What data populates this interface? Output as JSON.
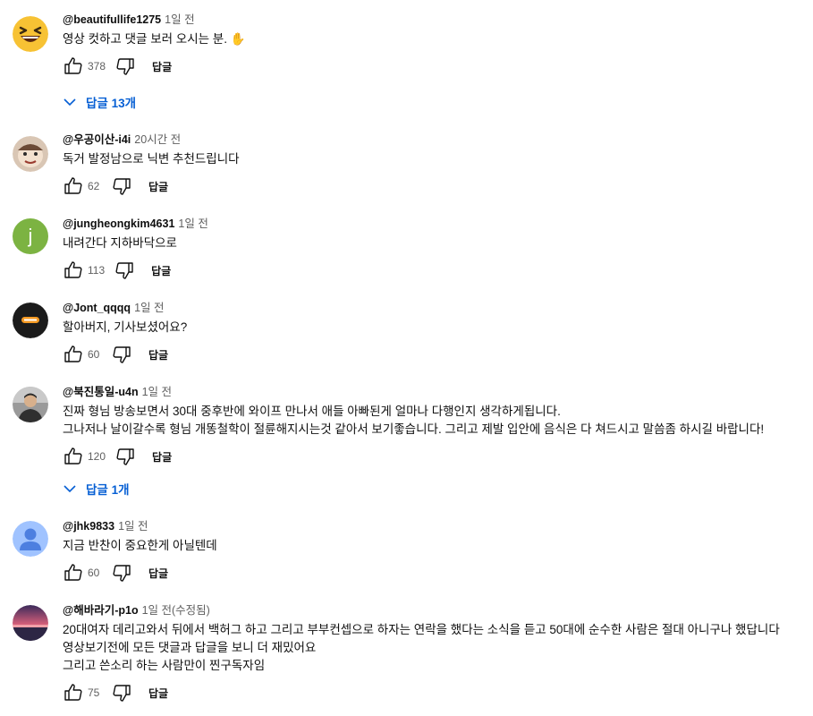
{
  "comments": [
    {
      "author": "@beautifullife1275",
      "time": "1일 전",
      "lines": [
        "영상 컷하고 댓글 보러 오시는 분. ✋"
      ],
      "likes": "378",
      "reply_label": "답글",
      "replies_label": "답글 13개",
      "avatar_icon": "laughing-emoji-avatar",
      "avatar_color": "#f7c234"
    },
    {
      "author": "@우공이산-i4i",
      "time": "20시간 전",
      "lines": [
        "독거 발정남으로 닉변 추천드립니다"
      ],
      "likes": "62",
      "reply_label": "답글",
      "avatar_icon": "cartoon-face-avatar",
      "avatar_color": "#d9c6b4"
    },
    {
      "author": "@jungheongkim4631",
      "time": "1일 전",
      "lines": [
        "내려간다 지하바닥으로"
      ],
      "likes": "113",
      "reply_label": "답글",
      "avatar_letter": "j",
      "avatar_color": "#7cb342"
    },
    {
      "author": "@Jont_qqqq",
      "time": "1일 전",
      "lines": [
        "할아버지, 기사보셨어요?"
      ],
      "likes": "60",
      "reply_label": "답글",
      "avatar_icon": "dark-logo-avatar",
      "avatar_color": "#1b1b1b"
    },
    {
      "author": "@북진통일-u4n",
      "time": "1일 전",
      "lines": [
        "진짜 형님 방송보면서 30대 중후반에 와이프 만나서 애들 아빠된게 얼마나 다행인지 생각하게됩니다.",
        "그나저나 날이갈수록 형님 개똥철학이 절륜해지시는것 같아서 보기좋습니다. 그리고 제발 입안에 음식은 다 쳐드시고 말씀좀 하시길 바랍니다!"
      ],
      "likes": "120",
      "reply_label": "답글",
      "replies_label": "답글 1개",
      "avatar_icon": "person-photo-avatar",
      "avatar_color": "#8d8d8d"
    },
    {
      "author": "@jhk9833",
      "time": "1일 전",
      "lines": [
        "지금 반찬이 중요한게 아닐텐데"
      ],
      "likes": "60",
      "reply_label": "답글",
      "avatar_icon": "default-person-avatar",
      "avatar_color": "#a0c3ff"
    },
    {
      "author": "@해바라기-p1o",
      "time": "1일 전(수정됨)",
      "lines": [
        "20대여자 데리고와서 뒤에서 백허그 하고 그리고 부부컨셉으로 하자는 연락을 했다는 소식을 듣고 50대에 순수한 사람은 절대 아니구나 했답니다",
        "영상보기전에 모든 댓글과 답글을 보니 더 재밌어요",
        "그리고 쓴소리 하는 사람만이 찐구독자임"
      ],
      "likes": "75",
      "reply_label": "답글",
      "avatar_icon": "sunset-photo-avatar",
      "avatar_color": "#5b3a6e"
    }
  ],
  "icons": {
    "like": "thumbs-up-icon",
    "dislike": "thumbs-down-icon",
    "expand": "chevron-down-icon"
  },
  "colors": {
    "link": "#065fd4",
    "secondary_text": "#606060"
  }
}
